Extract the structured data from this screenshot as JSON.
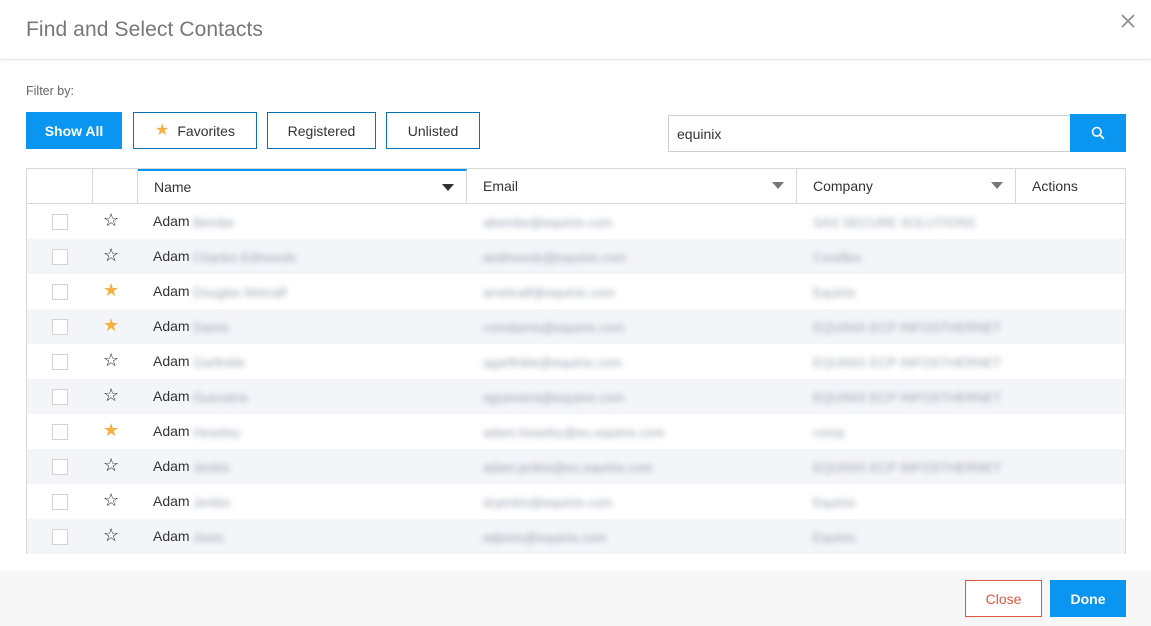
{
  "dialog": {
    "title": "Find and Select Contacts"
  },
  "filter": {
    "label": "Filter by:",
    "buttons": {
      "show_all": "Show All",
      "favorites": "Favorites",
      "registered": "Registered",
      "unlisted": "Unlisted"
    }
  },
  "search": {
    "value": "equinix"
  },
  "table": {
    "columns": {
      "name": "Name",
      "email": "Email",
      "company": "Company",
      "actions": "Actions"
    },
    "rows": [
      {
        "favorite": false,
        "first_name": "Adam",
        "last_name": "Bembe",
        "email": "abembe@equinix.com",
        "company": "SAS SECURE SOLUTIONS"
      },
      {
        "favorite": false,
        "first_name": "Adam",
        "last_name": "Charles Edmonds",
        "email": "aedmonds@equinix.com",
        "company": "Coreflex"
      },
      {
        "favorite": true,
        "first_name": "Adam",
        "last_name": "Douglas Metcalf",
        "email": "ametcalf@equinix.com",
        "company": "Equinix"
      },
      {
        "favorite": true,
        "first_name": "Adam",
        "last_name": "Dainis",
        "email": "comdainis@equinix.com",
        "company": "EQUINIX ECP INFOSTHERNET"
      },
      {
        "favorite": false,
        "first_name": "Adam",
        "last_name": "Garfinkle",
        "email": "agarfinkle@equinix.com",
        "company": "EQUINIX ECP INFOSTHERNET"
      },
      {
        "favorite": false,
        "first_name": "Adam",
        "last_name": "Guevarra",
        "email": "aguevarra@equinix.com",
        "company": "EQUINIX ECP INFOSTHERNET"
      },
      {
        "favorite": true,
        "first_name": "Adam",
        "last_name": "Heasley",
        "email": "adam.heasley@eu.equinix.com",
        "company": "comp"
      },
      {
        "favorite": false,
        "first_name": "Adam",
        "last_name": "Jenkis",
        "email": "adam.jenkis@eu.equinix.com",
        "company": "EQUINIX ECP INFOSTHERNET"
      },
      {
        "favorite": false,
        "first_name": "Adam",
        "last_name": "Jenkis",
        "email": "dcjenkis@equinix.com",
        "company": "Equinix"
      },
      {
        "favorite": false,
        "first_name": "Adam",
        "last_name": "Jonis",
        "email": "adjonis@equinix.com",
        "company": "Equinix"
      }
    ]
  },
  "footer": {
    "close": "Close",
    "done": "Done"
  },
  "icons": {
    "star_filled": "★",
    "star_empty": "☆",
    "search": "search-icon",
    "close": "close-icon"
  },
  "colors": {
    "primary": "#0a96f0",
    "star": "#f5b042",
    "danger": "#e0563d",
    "row_alt": "#f4f5f9"
  }
}
